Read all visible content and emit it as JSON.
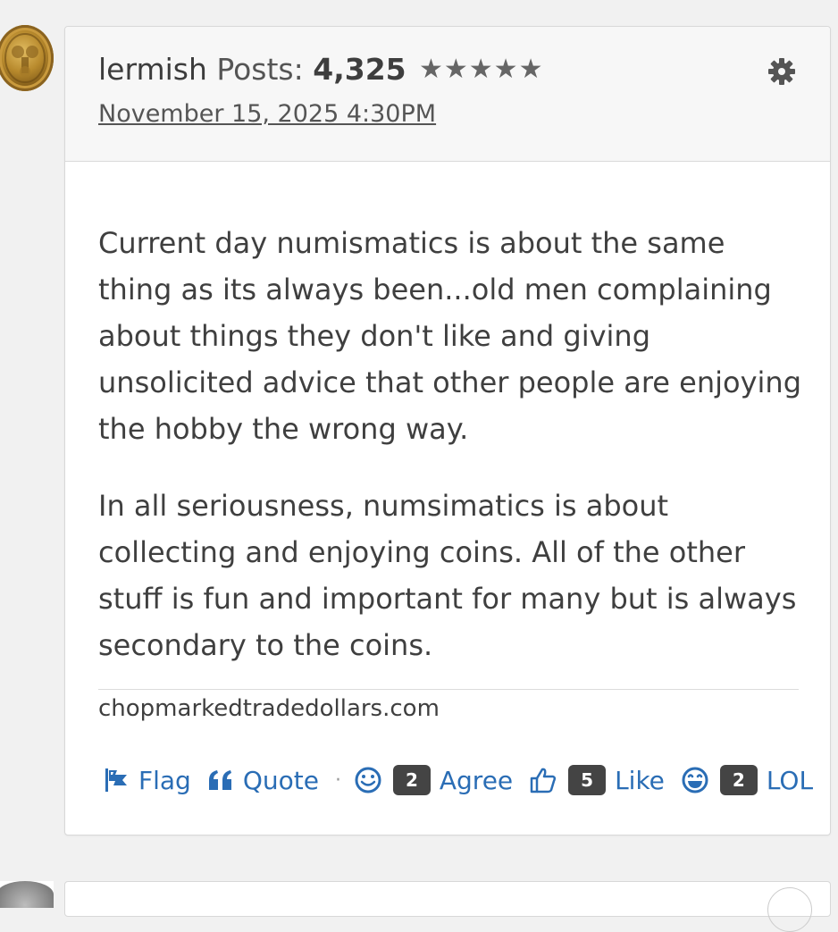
{
  "post": {
    "author": "lermish",
    "posts_label": "Posts:",
    "posts_count": "4,325",
    "stars": "★★★★★",
    "date": "November 15, 2025 4:30PM",
    "paragraphs": [
      "Current day numismatics is about the same thing as its always been...old men complaining about things they don't like and giving unsolicited advice that other people are enjoying the hobby the wrong way.",
      "In all seriousness, numsimatics is about collecting and enjoying coins. All of the other stuff is fun and important for many but is always secondary to the coins."
    ],
    "signature": "chopmarkedtradedollars.com"
  },
  "actions": {
    "flag_label": "Flag",
    "quote_label": "Quote",
    "separator": "·",
    "agree_count": "2",
    "agree_label": "Agree",
    "like_count": "5",
    "like_label": "Like",
    "lol_count": "2",
    "lol_label": "LOL"
  },
  "icons": {
    "avatar": "coin-avatar",
    "settings": "gear-icon",
    "flag": "flag-icon",
    "quote": "quote-icon",
    "agree": "smile-icon",
    "like": "thumbs-up-icon",
    "lol": "laugh-icon"
  },
  "colors": {
    "link": "#2a6db5",
    "badge": "#444444",
    "header_bg": "#f7f7f7",
    "page_bg": "#f1f1f1"
  }
}
